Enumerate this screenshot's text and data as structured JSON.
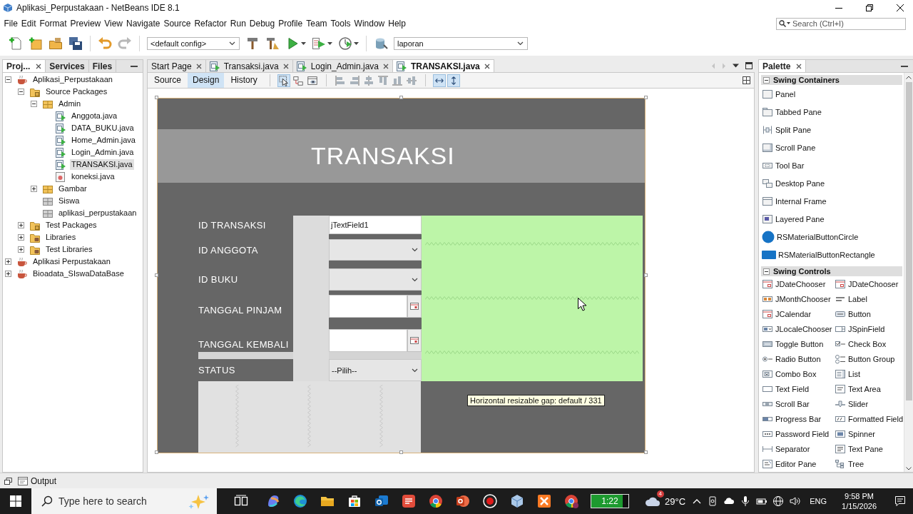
{
  "window": {
    "title": "Aplikasi_Perpustakaan - NetBeans IDE 8.1"
  },
  "menu": [
    "File",
    "Edit",
    "Format",
    "Preview",
    "View",
    "Navigate",
    "Source",
    "Refactor",
    "Run",
    "Debug",
    "Profile",
    "Team",
    "Tools",
    "Window",
    "Help"
  ],
  "search": {
    "placeholder": "Search (Ctrl+I)"
  },
  "toolbar": {
    "history_buttons": [
      {
        "disabled": false
      },
      {
        "disabled": true
      }
    ],
    "config": "<default config>",
    "dropdown": "laporan"
  },
  "project_panel": {
    "tabs": [
      {
        "label": "Proj...",
        "selected": true
      },
      {
        "label": "Services",
        "selected": false
      },
      {
        "label": "Files",
        "selected": false
      }
    ],
    "tree": [
      {
        "label": "Aplikasi_Perpustakaan",
        "kind": "project",
        "expanded": true,
        "selected": false,
        "children": [
          {
            "label": "Source Packages",
            "kind": "source-folder",
            "expanded": true,
            "selected": false,
            "children": [
              {
                "label": "Admin",
                "kind": "package",
                "expanded": true,
                "selected": false,
                "children": [
                  {
                    "label": "Anggota.java",
                    "kind": "form-file",
                    "selected": false
                  },
                  {
                    "label": "DATA_BUKU.java",
                    "kind": "form-file",
                    "selected": false
                  },
                  {
                    "label": "Home_Admin.java",
                    "kind": "form-file",
                    "selected": false
                  },
                  {
                    "label": "Login_Admin.java",
                    "kind": "form-file",
                    "selected": false
                  },
                  {
                    "label": "TRANSAKSI.java",
                    "kind": "form-file",
                    "selected": true
                  },
                  {
                    "label": "koneksi.java",
                    "kind": "class-file",
                    "selected": false
                  }
                ]
              },
              {
                "label": "Gambar",
                "kind": "package",
                "expanded": false,
                "selected": false
              },
              {
                "label": "Siswa",
                "kind": "empty-package",
                "selected": false
              },
              {
                "label": "aplikasi_perpustakaan",
                "kind": "empty-package",
                "selected": false
              }
            ]
          },
          {
            "label": "Test Packages",
            "kind": "source-folder",
            "expanded": false,
            "selected": false
          },
          {
            "label": "Libraries",
            "kind": "library-folder",
            "expanded": false,
            "selected": false
          },
          {
            "label": "Test Libraries",
            "kind": "library-folder",
            "expanded": false,
            "selected": false
          }
        ]
      },
      {
        "label": "Aplikasi Perpustakaan",
        "kind": "project",
        "expanded": false,
        "selected": false
      },
      {
        "label": "Bioadata_SIswaDataBase",
        "kind": "project",
        "expanded": false,
        "selected": false
      }
    ]
  },
  "editor": {
    "tabs": [
      {
        "label": "Start Page",
        "kind": "page",
        "selected": false
      },
      {
        "label": "Transaksi.java",
        "kind": "form",
        "selected": false
      },
      {
        "label": "Login_Admin.java",
        "kind": "form",
        "selected": false
      },
      {
        "label": "TRANSAKSI.java",
        "kind": "form",
        "selected": true
      }
    ],
    "views": [
      {
        "label": "Source",
        "selected": false
      },
      {
        "label": "Design",
        "selected": true
      },
      {
        "label": "History",
        "selected": false
      }
    ],
    "tools": [
      {
        "selected": true
      },
      {
        "selected": false
      },
      {
        "selected": false
      }
    ],
    "resize_tools": [
      {
        "selected": true
      },
      {
        "selected": true
      }
    ],
    "form": {
      "title": "TRANSAKSI",
      "fields": [
        {
          "label": "ID TRANSAKSI",
          "kind": "text",
          "value": "jTextField1"
        },
        {
          "label": "ID ANGGOTA",
          "kind": "combo"
        },
        {
          "label": "ID BUKU",
          "kind": "combo"
        },
        {
          "label": "TANGGAL PINJAM",
          "kind": "date"
        },
        {
          "label": "TANGGAL KEMBALI",
          "kind": "date"
        },
        {
          "label": "STATUS",
          "kind": "combo",
          "value": "--Pilih--"
        }
      ]
    },
    "tooltip": "Horizontal resizable gap: default / 331"
  },
  "palette": {
    "title": "Palette",
    "sections": [
      {
        "title": "Swing Containers",
        "kind": "list",
        "expanded": true,
        "items": [
          "Panel",
          "Tabbed Pane",
          "Split Pane",
          "Scroll Pane",
          "Tool Bar",
          "Desktop Pane",
          "Internal Frame",
          "Layered Pane",
          "RSMaterialButtonCircle",
          "RSMaterialButtonRectangle"
        ]
      },
      {
        "title": "Swing Controls",
        "kind": "grid",
        "expanded": true,
        "items": [
          "JDateChooser",
          "JDateChooser",
          "JMonthChooser",
          "Label",
          "JCalendar",
          "Button",
          "JLocaleChooser",
          "JSpinField",
          "Toggle Button",
          "Check Box",
          "Radio Button",
          "Button Group",
          "Combo Box",
          "List",
          "Text Field",
          "Text Area",
          "Scroll Bar",
          "Slider",
          "Progress Bar",
          "Formatted Field",
          "Password Field",
          "Spinner",
          "Separator",
          "Text Pane",
          "Editor Pane",
          "Tree"
        ]
      }
    ]
  },
  "output": {
    "label": "Output"
  },
  "taskbar": {
    "search_placeholder": "Type here to search",
    "recorder_time": "1:22",
    "weather_badge": "4",
    "temperature": "29°C",
    "language": "ENG",
    "time": "9:58 PM",
    "date": "1/15/2026"
  }
}
